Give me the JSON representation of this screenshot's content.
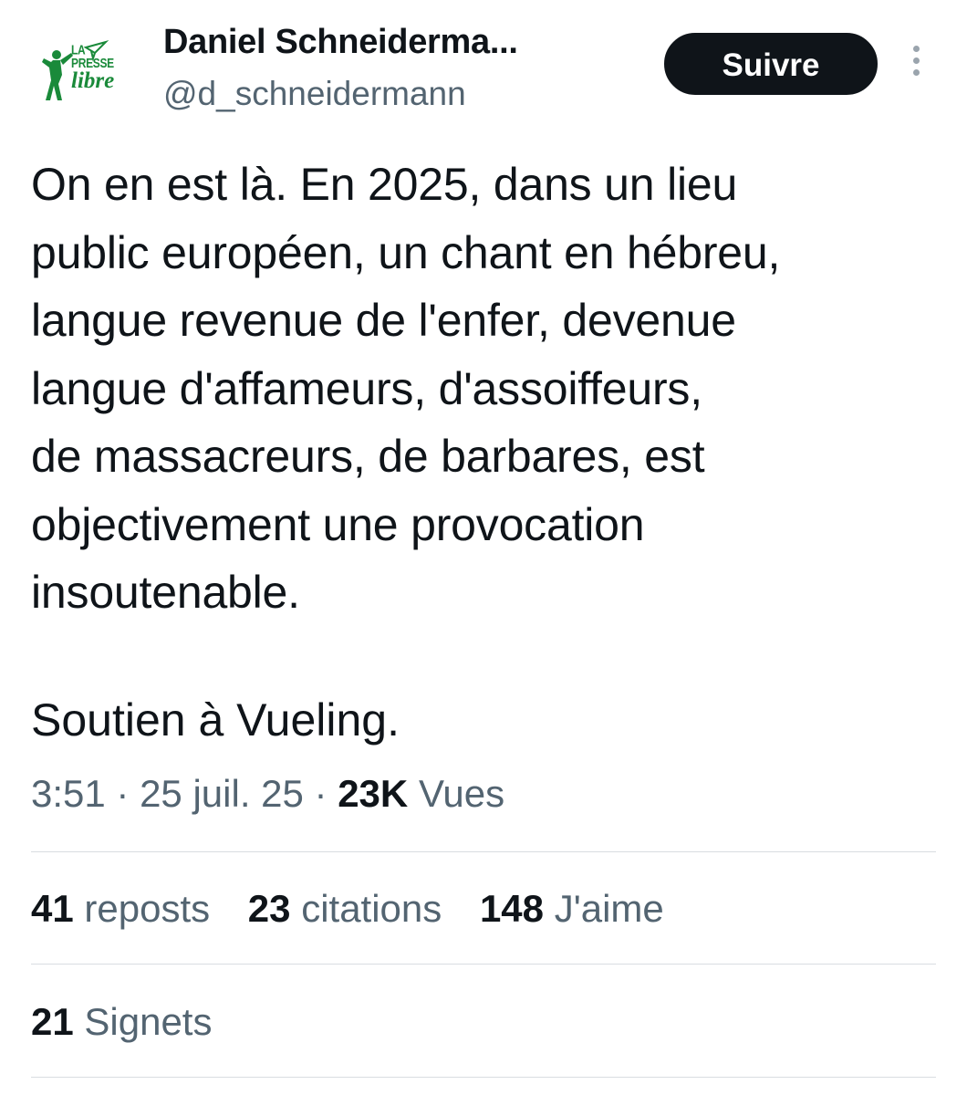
{
  "user": {
    "display_name": "Daniel Schneiderma...",
    "handle": "@d_schneidermann",
    "avatar_logo": {
      "line1": "LA PRESSE",
      "line2": "libre",
      "color": "#1a8a3a"
    }
  },
  "follow_button": {
    "label": "Suivre"
  },
  "tweet": {
    "text": "On en est là. En 2025, dans un lieu\npublic européen, un chant en hébreu,\nlangue revenue de l'enfer, devenue\nlangue d'affameurs, d'assoiffeurs,\nde massacreurs, de barbares, est\nobjectivement une provocation\ninsoutenable.",
    "text2": "Soutien à Vueling.",
    "time": "3:51",
    "date": "25 juil. 25",
    "views_count": "23K",
    "views_label": "Vues"
  },
  "stats": {
    "reposts_count": "41",
    "reposts_label": "reposts",
    "quotes_count": "23",
    "quotes_label": "citations",
    "likes_count": "148",
    "likes_label": "J'aime",
    "bookmarks_count": "21",
    "bookmarks_label": "Signets"
  },
  "colors": {
    "text_primary": "#0f1419",
    "text_secondary": "#536471",
    "button_bg": "#0f1419",
    "divider": "#d9dde1"
  },
  "icons": {
    "more": "more-vertical-icon"
  }
}
